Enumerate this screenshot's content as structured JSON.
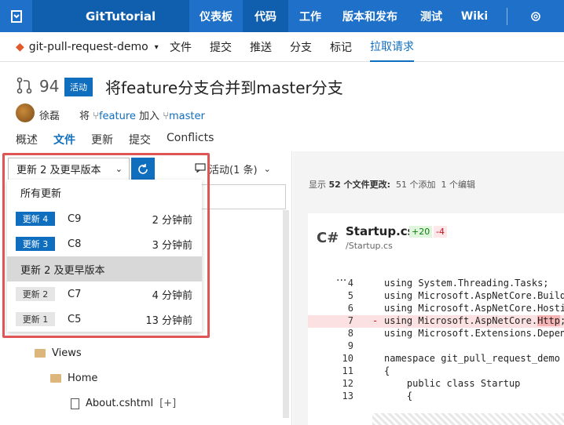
{
  "header": {
    "project": "GitTutorial",
    "nav": [
      "仪表板",
      "代码",
      "工作",
      "版本和发布",
      "测试",
      "Wiki"
    ],
    "active_nav": "代码"
  },
  "subnav": {
    "repo": "git-pull-request-demo",
    "items": [
      "文件",
      "提交",
      "推送",
      "分支",
      "标记",
      "拉取请求"
    ],
    "active": "拉取请求"
  },
  "pr": {
    "number": "94",
    "status": "活动",
    "title": "将feature分支合并到master分支",
    "author": "徐磊",
    "merge_prefix": "将",
    "source_branch": "feature",
    "merge_middle": "加入",
    "target_branch": "master"
  },
  "tabs": [
    "概述",
    "文件",
    "更新",
    "提交",
    "Conflicts"
  ],
  "active_tab": "文件",
  "toolbar": {
    "update_select": "更新 2 及更早版本",
    "activity": "活动(1 条)"
  },
  "dropdown": {
    "header": "所有更新",
    "items": [
      {
        "tag": "更新 4",
        "commit": "C9",
        "time": "2 分钟前",
        "style": "blue"
      },
      {
        "tag": "更新 3",
        "commit": "C8",
        "time": "3 分钟前",
        "style": "blue"
      },
      {
        "group": "更新 2 及更早版本"
      },
      {
        "tag": "更新 2",
        "commit": "C7",
        "time": "4 分钟前",
        "style": "gray"
      },
      {
        "tag": "更新 1",
        "commit": "C5",
        "time": "13 分钟前",
        "style": "gray"
      }
    ]
  },
  "tree": {
    "views": "Views",
    "home": "Home",
    "about": "About.cshtml",
    "about_badge": "[+]"
  },
  "diff": {
    "summary_prefix": "显示",
    "summary_count": "52 个文件更改:",
    "summary_added": "51 个添加",
    "summary_edited": "1 个编辑",
    "language": "C#",
    "file_name": "Startup.cs",
    "additions": "+20",
    "deletions": "-4",
    "file_path": "/Startup.cs",
    "ellipsis": "...",
    "lines": [
      {
        "num": "4",
        "text": "using System.Threading.Tasks;"
      },
      {
        "num": "5",
        "text": "using Microsoft.AspNetCore.Build"
      },
      {
        "num": "6",
        "text": "using Microsoft.AspNetCore.Hosti"
      },
      {
        "num": "7",
        "text": "using Microsoft.AspNetCore.Http;",
        "removed": true,
        "marker": "-"
      },
      {
        "num": "8",
        "text": "using Microsoft.Extensions.Depen"
      },
      {
        "num": "9",
        "text": ""
      },
      {
        "num": "10",
        "text": "namespace git_pull_request_demo"
      },
      {
        "num": "11",
        "text": "{"
      },
      {
        "num": "12",
        "text": "    public class Startup"
      },
      {
        "num": "13",
        "text": "    {"
      }
    ]
  },
  "colors": {
    "brand": "#1e70c8",
    "accent": "#106ebe",
    "highlight_border": "#e05555"
  }
}
